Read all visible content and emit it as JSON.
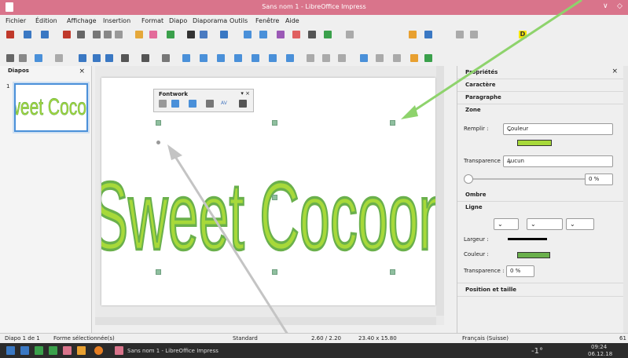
{
  "window": {
    "title": "Sans nom 1 - LibreOffice Impress",
    "controls": [
      "∨",
      "◇"
    ]
  },
  "menubar": [
    "Fichier",
    "Édition",
    "Affichage",
    "Insertion",
    "Format",
    "Diapo",
    "Diaporama",
    "Outils",
    "Fenêtre",
    "Aide"
  ],
  "slides_panel": {
    "title": "Diapos",
    "close": "×",
    "slide_number": "1"
  },
  "fontwork_toolbar": {
    "title": "Fontwork",
    "close": "▾ ×",
    "spacing_label": "AV"
  },
  "fontwork_text": "Sweet Cocoon",
  "properties": {
    "title": "Propriétés",
    "close": "×",
    "sections": {
      "caractere": "Caractère",
      "paragraphe": "Paragraphe",
      "zone": "Zone",
      "ombre": "Ombre",
      "ligne": "Ligne",
      "position": "Position et taille"
    },
    "fill_label": "Remplir :",
    "fill_value": "Couleur",
    "transparency_label": "Transparence :",
    "transparency_value": "Aucun",
    "transparency_percent": "0 %",
    "line_width_label": "Largeur :",
    "line_color_label": "Couleur :",
    "line_transparency_label": "Transparence :",
    "line_transparency_value": "0 %",
    "fill_color": "#a7d93a",
    "line_color": "#6ab04c"
  },
  "status": {
    "slide": "Diapo 1 de 1",
    "selection": "Forme sélectionnée(s)",
    "layout": "Standard",
    "position": "2.60 / 2.20",
    "size": "23.40 x 15.80",
    "language": "Français (Suisse)",
    "zoom": "61"
  },
  "taskbar": {
    "app_label": "Sans nom 1 - LibreOffice Impress",
    "temperature": "-1°",
    "time": "09:24",
    "date": "06.12.18"
  },
  "colors": {
    "titlebar": "#d9748b",
    "arrow_green": "#8ed36c",
    "arrow_gray": "#c4c4c4"
  }
}
